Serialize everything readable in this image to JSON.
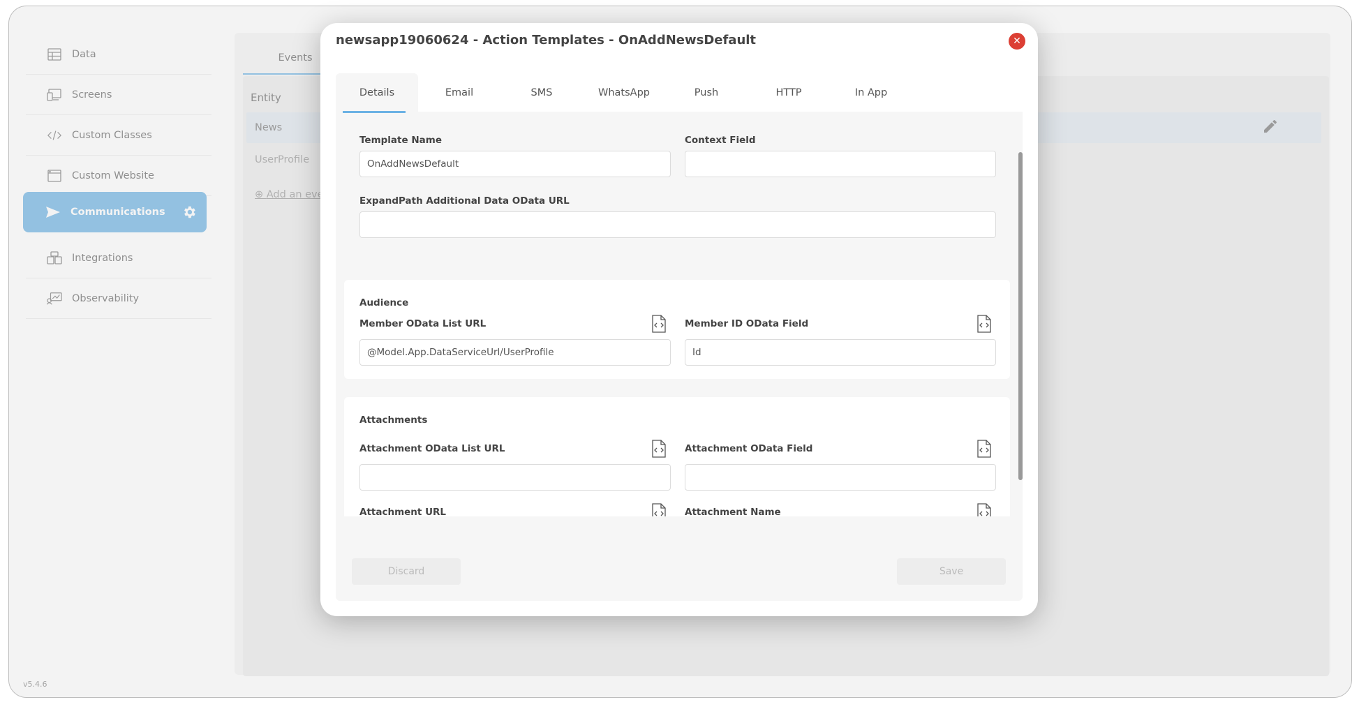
{
  "sidebar": {
    "items": [
      {
        "label": "Data",
        "icon": "table-icon"
      },
      {
        "label": "Screens",
        "icon": "screens-icon"
      },
      {
        "label": "Custom Classes",
        "icon": "code-icon"
      },
      {
        "label": "Custom Website",
        "icon": "browser-icon"
      },
      {
        "label": "Communications",
        "icon": "send-icon",
        "active": true
      },
      {
        "label": "Integrations",
        "icon": "integrations-icon"
      },
      {
        "label": "Observability",
        "icon": "observability-icon"
      }
    ],
    "version": "v5.4.6"
  },
  "background": {
    "tab": "Events",
    "entity_header": "Entity",
    "rows": [
      "News",
      "UserProfile"
    ],
    "add_link": "Add an eve"
  },
  "modal": {
    "title": "newsapp19060624 - Action Templates - OnAddNewsDefault",
    "tabs": [
      "Details",
      "Email",
      "SMS",
      "WhatsApp",
      "Push",
      "HTTP",
      "In App"
    ],
    "active_tab": "Details",
    "template_name_label": "Template Name",
    "template_name_value": "OnAddNewsDefault",
    "context_field_label": "Context Field",
    "context_field_value": "",
    "expand_path_label": "ExpandPath Additional Data OData URL",
    "expand_path_value": "",
    "audience": {
      "title": "Audience",
      "member_list_label": "Member OData List URL",
      "member_list_value": "@Model.App.DataServiceUrl/UserProfile",
      "member_id_label": "Member ID OData Field",
      "member_id_value": "Id"
    },
    "attachments": {
      "title": "Attachments",
      "list_url_label": "Attachment OData List URL",
      "field_label": "Attachment OData Field",
      "url_label": "Attachment URL",
      "name_label": "Attachment Name"
    },
    "discard_label": "Discard",
    "save_label": "Save"
  },
  "colors": {
    "accent": "#6cb2e4",
    "close": "#dc3f34"
  }
}
